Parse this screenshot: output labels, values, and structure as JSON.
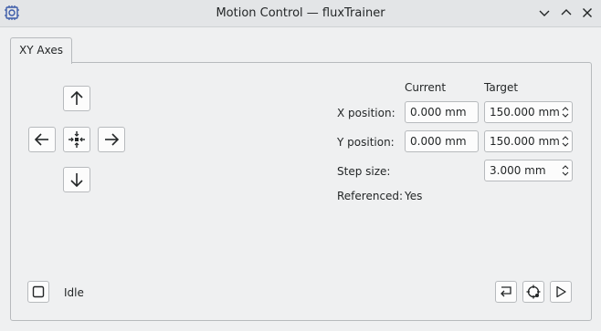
{
  "window": {
    "title": "Motion Control — fluxTrainer",
    "app_icon": "chip-gear-icon",
    "controls": [
      "minimize-icon",
      "maximize-icon",
      "close-icon"
    ]
  },
  "tabs": [
    {
      "label": "XY Axes",
      "active": true
    }
  ],
  "jog": {
    "buttons": [
      "arrow-up-icon",
      "arrow-left-icon",
      "home-center-icon",
      "arrow-right-icon",
      "arrow-down-icon"
    ]
  },
  "positions": {
    "current_header": "Current",
    "target_header": "Target",
    "x_label": "X position:",
    "x_current": "0.000 mm",
    "x_target": "150.000 mm",
    "y_label": "Y position:",
    "y_current": "0.000 mm",
    "y_target": "150.000 mm",
    "step_label": "Step size:",
    "step_value": "3.000 mm",
    "referenced_label": "Referenced:",
    "referenced_value": "Yes"
  },
  "status": {
    "stop_icon": "stop-icon",
    "text": "Idle"
  },
  "actions": [
    "return-icon",
    "reference-target-icon",
    "play-icon"
  ],
  "colors": {
    "background": "#eff0f1",
    "titlebar": "#e3e5e7",
    "border": "#b7babd",
    "field": "#fcfcfc",
    "text": "#232627"
  }
}
